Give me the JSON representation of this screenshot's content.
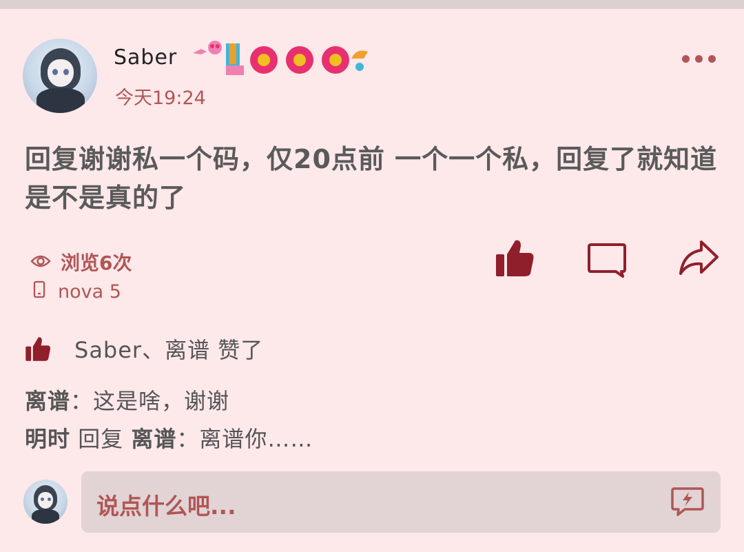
{
  "post": {
    "author": "Saber",
    "time": "今天19:24",
    "content": "回复谢谢私一个码，仅20点前 一个一个私，回复了就知道是不是真的了",
    "views": "浏览6次",
    "device": "nova 5"
  },
  "likes": {
    "text": "Saber、离谱 赞了"
  },
  "comments": [
    {
      "author": "离谱",
      "separator": "：",
      "text": "这是啥，谢谢"
    },
    {
      "author": "明时",
      "reply_word": " 回复 ",
      "reply_to": "离谱",
      "separator": "：",
      "text": "离谱你……"
    }
  ],
  "input": {
    "placeholder": "说点什么吧..."
  },
  "icons": {
    "more": "more-dots-icon",
    "views": "eye-icon",
    "device": "phone-icon",
    "like": "thumbs-up-icon",
    "comment": "comment-bubble-icon",
    "share": "share-arrow-icon",
    "quick": "lightning-bubble-icon"
  },
  "colors": {
    "background": "#fde8ea",
    "accent": "#b05656",
    "like_red": "#8f1f2b"
  }
}
